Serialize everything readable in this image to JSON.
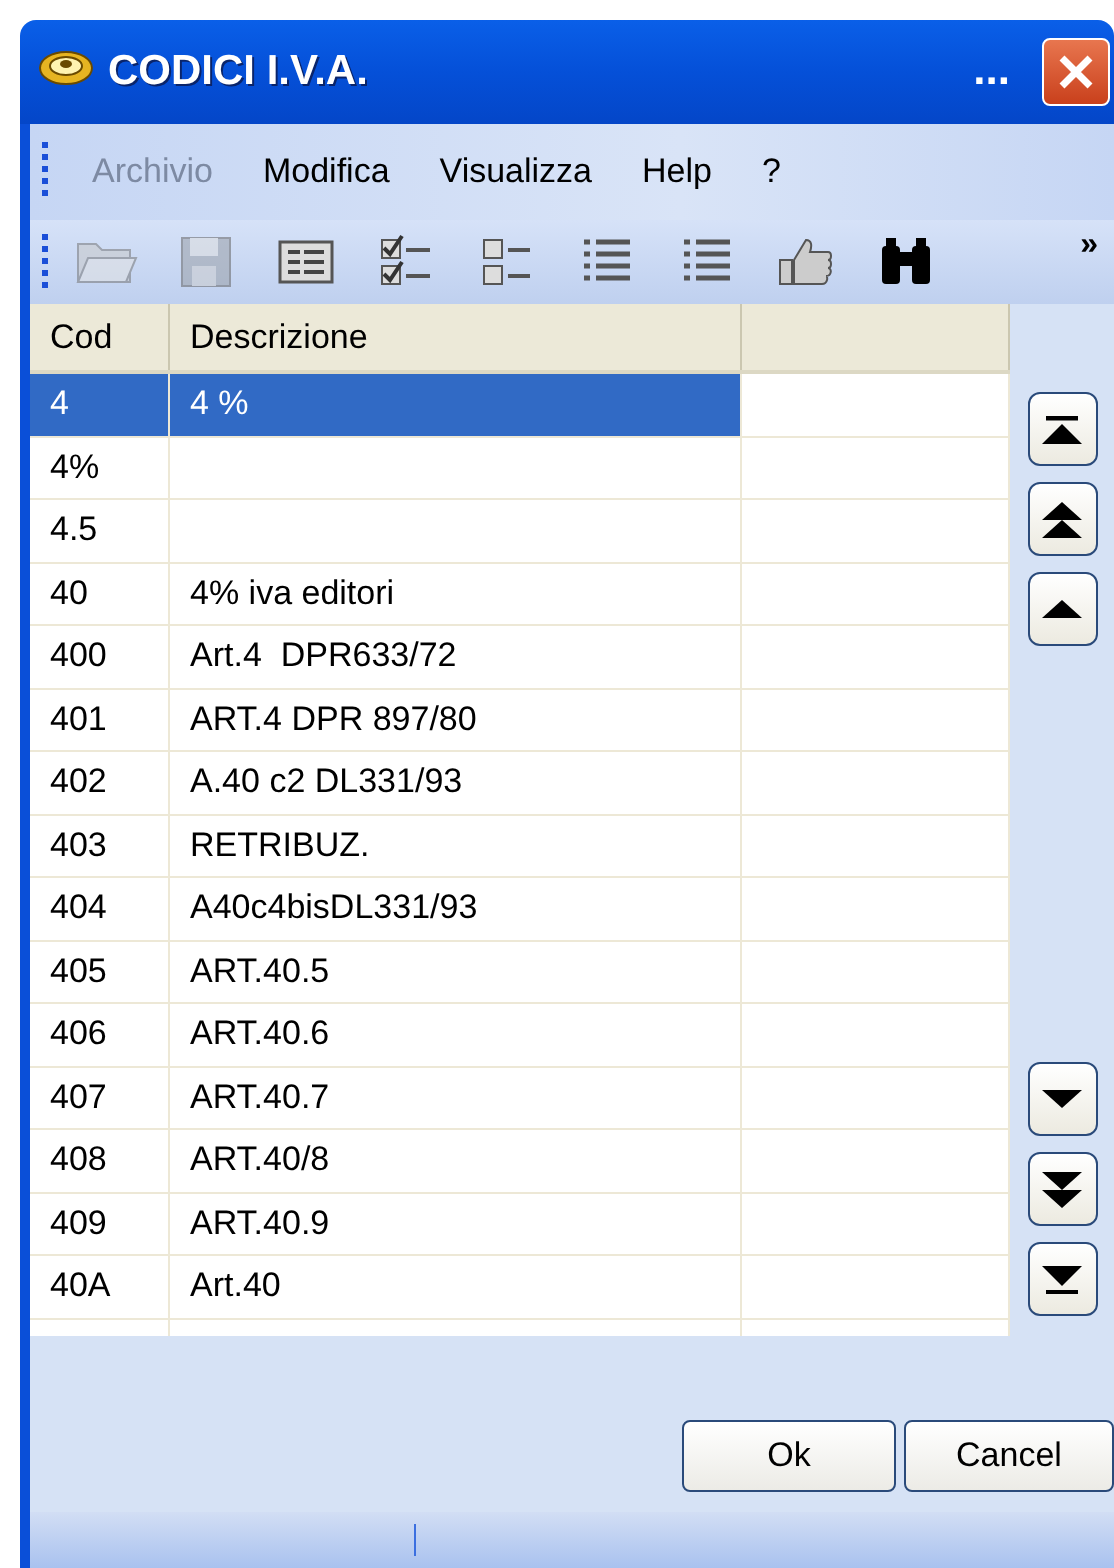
{
  "window": {
    "title": "CODICI I.V.A.",
    "title_extra": "..."
  },
  "menu": [
    {
      "label": "Archivio",
      "disabled": true
    },
    {
      "label": "Modifica",
      "disabled": false
    },
    {
      "label": "Visualizza",
      "disabled": false
    },
    {
      "label": "Help",
      "disabled": false
    },
    {
      "label": "?",
      "disabled": false
    }
  ],
  "toolbar": {
    "tools": [
      {
        "kind": "folder",
        "disabled": true
      },
      {
        "kind": "save",
        "disabled": true
      },
      {
        "kind": "form",
        "disabled": false
      },
      {
        "kind": "checklist",
        "disabled": false
      },
      {
        "kind": "boxlist",
        "disabled": false
      },
      {
        "kind": "list",
        "disabled": false
      },
      {
        "kind": "list",
        "disabled": false
      },
      {
        "kind": "thumb",
        "disabled": false
      },
      {
        "kind": "binoculars",
        "disabled": false
      }
    ],
    "overflow": "»"
  },
  "table": {
    "columns": [
      "Cod",
      "Descrizione"
    ],
    "rows": [
      {
        "cod": "4",
        "descrizione": "4 %",
        "selected": true
      },
      {
        "cod": "4%",
        "descrizione": "",
        "selected": false
      },
      {
        "cod": "4.5",
        "descrizione": "",
        "selected": false
      },
      {
        "cod": "40",
        "descrizione": "4% iva editori",
        "selected": false
      },
      {
        "cod": "400",
        "descrizione": "Art.4  DPR633/72",
        "selected": false
      },
      {
        "cod": "401",
        "descrizione": "ART.4 DPR 897/80",
        "selected": false
      },
      {
        "cod": "402",
        "descrizione": "A.40 c2 DL331/93",
        "selected": false
      },
      {
        "cod": "403",
        "descrizione": "RETRIBUZ.",
        "selected": false
      },
      {
        "cod": "404",
        "descrizione": "A40c4bisDL331/93",
        "selected": false
      },
      {
        "cod": "405",
        "descrizione": "ART.40.5",
        "selected": false
      },
      {
        "cod": "406",
        "descrizione": "ART.40.6",
        "selected": false
      },
      {
        "cod": "407",
        "descrizione": "ART.40.7",
        "selected": false
      },
      {
        "cod": "408",
        "descrizione": "ART.40/8",
        "selected": false
      },
      {
        "cod": "409",
        "descrizione": "ART.40.9",
        "selected": false
      },
      {
        "cod": "40A",
        "descrizione": "Art.40",
        "selected": false
      }
    ]
  },
  "navigation": [
    {
      "kind": "first"
    },
    {
      "kind": "page-up"
    },
    {
      "kind": "up"
    },
    {
      "kind": "down"
    },
    {
      "kind": "page-down"
    },
    {
      "kind": "last"
    }
  ],
  "buttons": [
    "Ok",
    "Cancel"
  ]
}
